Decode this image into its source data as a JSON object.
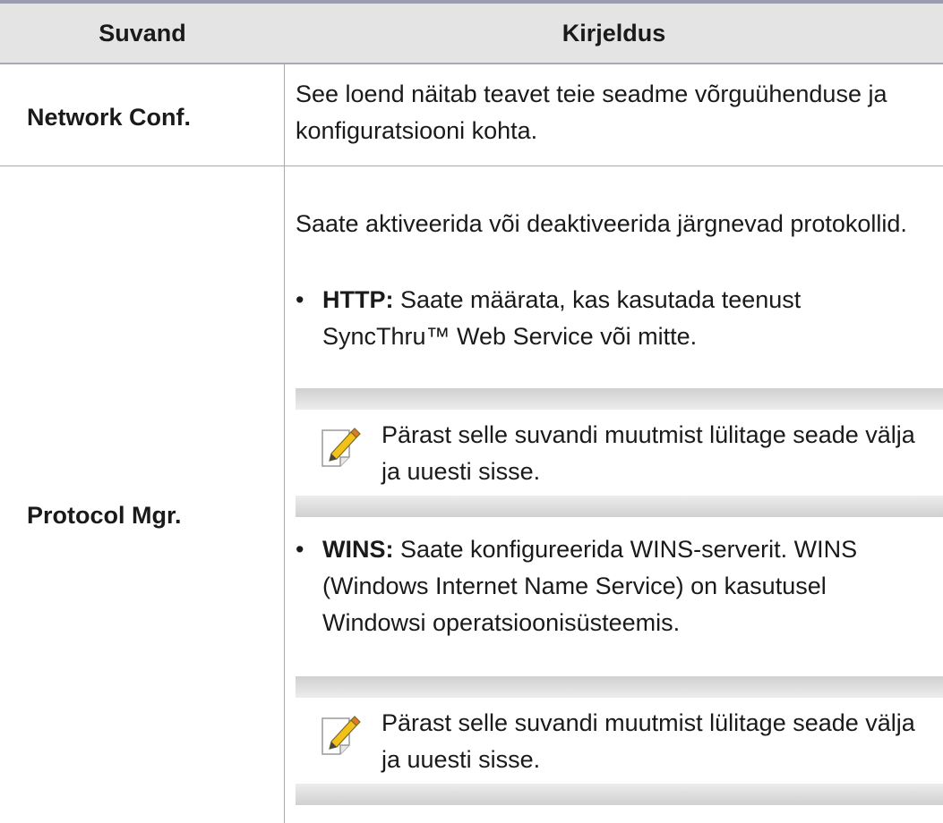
{
  "header": {
    "col_option": "Suvand",
    "col_description": "Kirjeldus"
  },
  "rows": [
    {
      "option": "Network Conf.",
      "description": "See loend näitab teavet teie seadme võrguühenduse ja konfiguratsiooni kohta."
    },
    {
      "option": "Protocol Mgr.",
      "intro": "Saate aktiveerida või deaktiveerida järgnevad protokollid.",
      "items": [
        {
          "bullet": "•",
          "term": "HTTP:",
          "text": " Saate määrata, kas kasutada teenust SyncThru™ Web Service või mitte.",
          "note_icon": "note-pencil-icon",
          "note": "Pärast selle suvandi muutmist lülitage seade välja ja uuesti sisse."
        },
        {
          "bullet": "•",
          "term": "WINS:",
          "text": " Saate konfigureerida WINS-serverit. WINS (Windows Internet Name Service) on kasutusel Windowsi operatsioonisüsteemis.",
          "note_icon": "note-pencil-icon",
          "note": "Pärast selle suvandi muutmist lülitage seade välja ja uuesti sisse."
        }
      ]
    }
  ],
  "colors": {
    "header_bg": "#e4e4e4",
    "rule": "#a8a8b8",
    "top_rule": "#9a9ab0",
    "note_band": "#d0d0d0",
    "icon_accent": "#f2c21b"
  }
}
